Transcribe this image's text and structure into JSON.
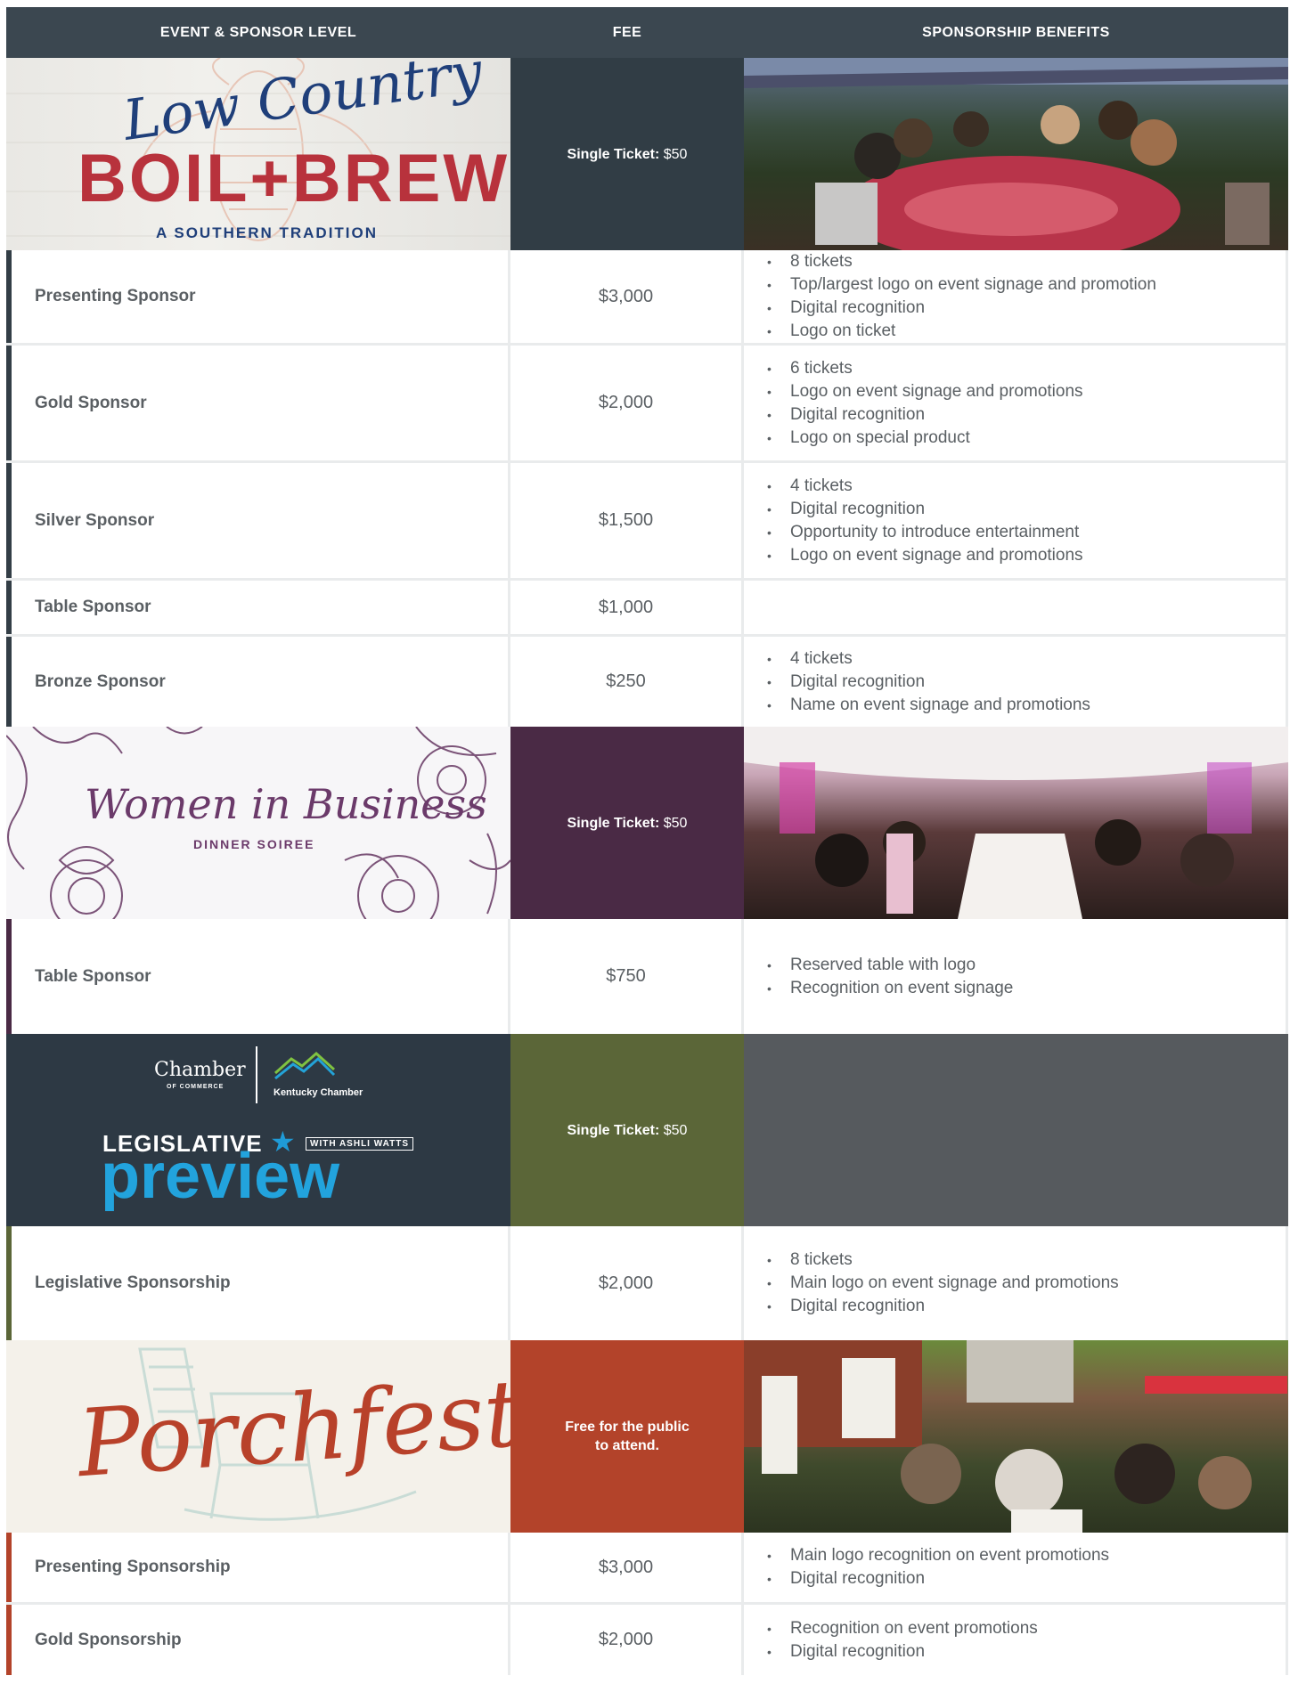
{
  "header": {
    "col1": "EVENT & SPONSOR LEVEL",
    "col2": "FEE",
    "col3": "SPONSORSHIP BENEFITS"
  },
  "events": [
    {
      "logo": {
        "line1": "Low Country",
        "line2": "BOIL+BREW",
        "line3": "A SOUTHERN TRADITION"
      },
      "fee_label": "Single Ticket:",
      "fee_value": "$50",
      "rows": [
        {
          "level": "Presenting Sponsor",
          "fee": "$3,000",
          "benefits": [
            "8 tickets",
            "Top/largest logo on event signage and promotion",
            "Digital recognition",
            "Logo on ticket"
          ]
        },
        {
          "level": "Gold Sponsor",
          "fee": "$2,000",
          "benefits": [
            "6 tickets",
            "Logo on event signage and promotions",
            "Digital recognition",
            "Logo on special product"
          ]
        },
        {
          "level": "Silver Sponsor",
          "fee": "$1,500",
          "benefits": [
            "4 tickets",
            "Digital recognition",
            "Opportunity to introduce entertainment",
            "Logo on event signage and promotions"
          ]
        },
        {
          "level": "Table Sponsor",
          "fee": "$1,000",
          "benefits": []
        },
        {
          "level": "Bronze Sponsor",
          "fee": "$250",
          "benefits": [
            "4 tickets",
            "Digital recognition",
            "Name on event signage and promotions"
          ]
        }
      ]
    },
    {
      "logo": {
        "line1": "Women in Business",
        "line2": "DINNER SOIREE"
      },
      "fee_label": "Single Ticket:",
      "fee_value": "$50",
      "rows": [
        {
          "level": "Table Sponsor",
          "fee": "$750",
          "benefits": [
            "Reserved table with logo",
            "Recognition on event signage"
          ]
        }
      ]
    },
    {
      "logo": {
        "chamber": "Chamber",
        "chamber_sub": "OF COMMERCE",
        "kentucky": "Kentucky Chamber",
        "line1": "LEGISLATIVE",
        "with": "WITH ASHLI WATTS",
        "line2": "preview"
      },
      "fee_label": "Single Ticket:",
      "fee_value": "$50",
      "rows": [
        {
          "level": "Legislative Sponsorship",
          "fee": "$2,000",
          "benefits": [
            "8 tickets",
            "Main logo on event signage and promotions",
            "Digital recognition"
          ]
        }
      ]
    },
    {
      "logo": {
        "line1": "Porchfest"
      },
      "fee_text": "Free for the public to attend.",
      "rows": [
        {
          "level": "Presenting Sponsorship",
          "fee": "$3,000",
          "benefits": [
            "Main logo recognition on event promotions",
            "Digital recognition"
          ]
        },
        {
          "level": "Gold Sponsorship",
          "fee": "$2,000",
          "benefits": [
            "Recognition on event promotions",
            "Digital recognition"
          ]
        }
      ]
    }
  ],
  "colors": {
    "header": "#3b4750",
    "boil_fee": "#313d45",
    "wib_fee": "#4a2a45",
    "leg_fee": "#5b6638",
    "leg_photo": "#565a5e",
    "leg_logo_bg": "#2d3944",
    "porch_fee": "#b3432a"
  }
}
